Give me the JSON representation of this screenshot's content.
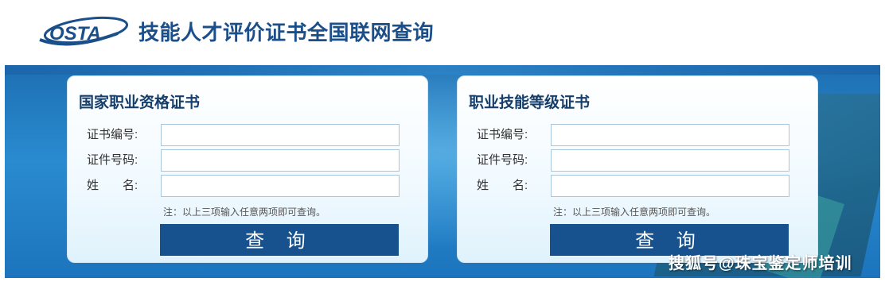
{
  "header": {
    "logo_text": "OSTA",
    "title": "技能人才评价证书全国联网查询"
  },
  "panels": [
    {
      "title": "国家职业资格证书",
      "fields": [
        {
          "label": "证书编号:",
          "value": "",
          "placeholder": ""
        },
        {
          "label": "证件号码:",
          "value": "",
          "placeholder": ""
        },
        {
          "label": "姓　　名:",
          "value": "",
          "placeholder": ""
        }
      ],
      "note": "注：以上三项输入任意两项即可查询。",
      "button_label": "查 询"
    },
    {
      "title": "职业技能等级证书",
      "fields": [
        {
          "label": "证书编号:",
          "value": "",
          "placeholder": ""
        },
        {
          "label": "证件号码:",
          "value": "",
          "placeholder": ""
        },
        {
          "label": "姓　　名:",
          "value": "",
          "placeholder": ""
        }
      ],
      "note": "注：以上三项输入任意两项即可查询。",
      "button_label": "查 询"
    }
  ],
  "watermark": "搜狐号@珠宝鉴定师培训",
  "colors": {
    "brand": "#1b4f8a",
    "button": "#17528f",
    "banner": "#2a8bd0"
  }
}
